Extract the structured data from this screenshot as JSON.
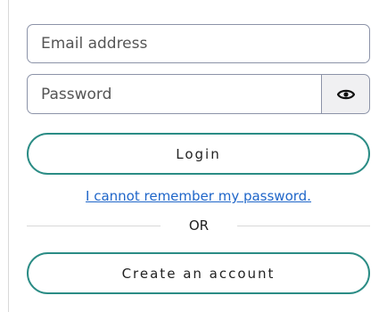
{
  "login_form": {
    "email_placeholder": "Email address",
    "password_placeholder": "Password",
    "toggle_password_icon": "eye-icon",
    "login_label": "Login",
    "forgot_password_link": "I cannot remember my password.",
    "divider_text": "OR",
    "create_account_label": "Create an account",
    "colors": {
      "accent_border": "#2b8c85",
      "link": "#1f66c9",
      "input_border": "#8c93a8",
      "divider": "#d9d9d9"
    }
  }
}
